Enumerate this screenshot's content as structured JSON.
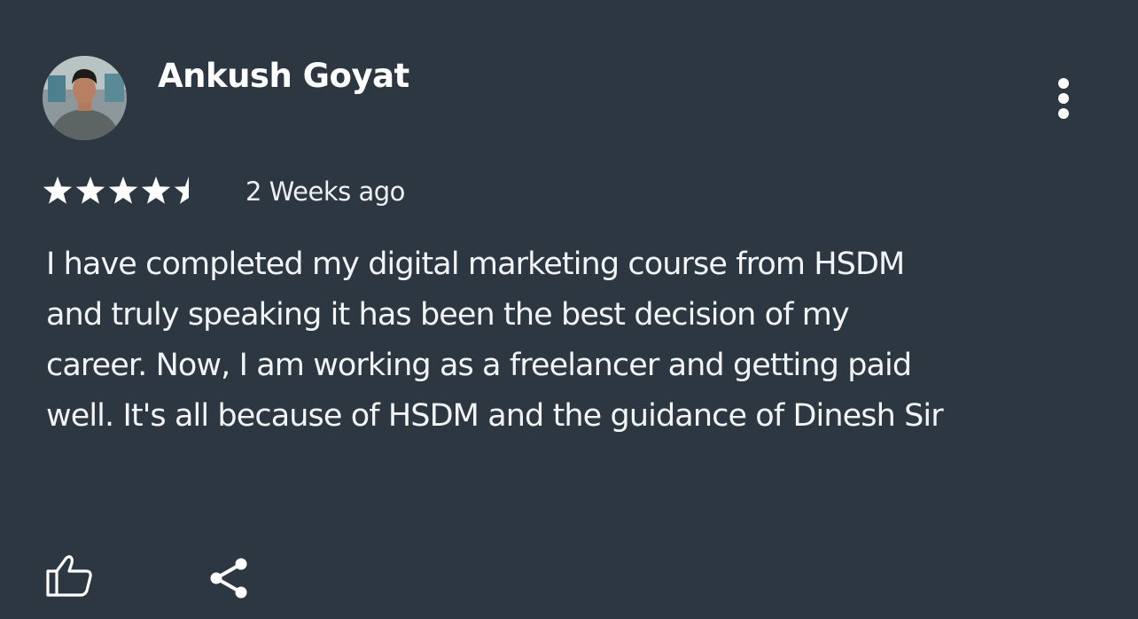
{
  "review": {
    "author": "Ankush Goyat",
    "rating": 4.5,
    "rating_max": 5,
    "time_ago": "2 Weeks ago",
    "body_lines": [
      "I have completed my digital marketing course from HSDM",
      "and truly speaking it has been the best decision of my",
      "career. Now, I am working as a freelancer and getting paid",
      "well. It's all because of HSDM and the guidance of Dinesh Sir"
    ]
  },
  "icons": {
    "more": "more-vertical-icon",
    "like": "thumbs-up-icon",
    "share": "share-icon",
    "star": "star-icon"
  },
  "colors": {
    "background": "#2c3742",
    "text": "#ffffff"
  }
}
